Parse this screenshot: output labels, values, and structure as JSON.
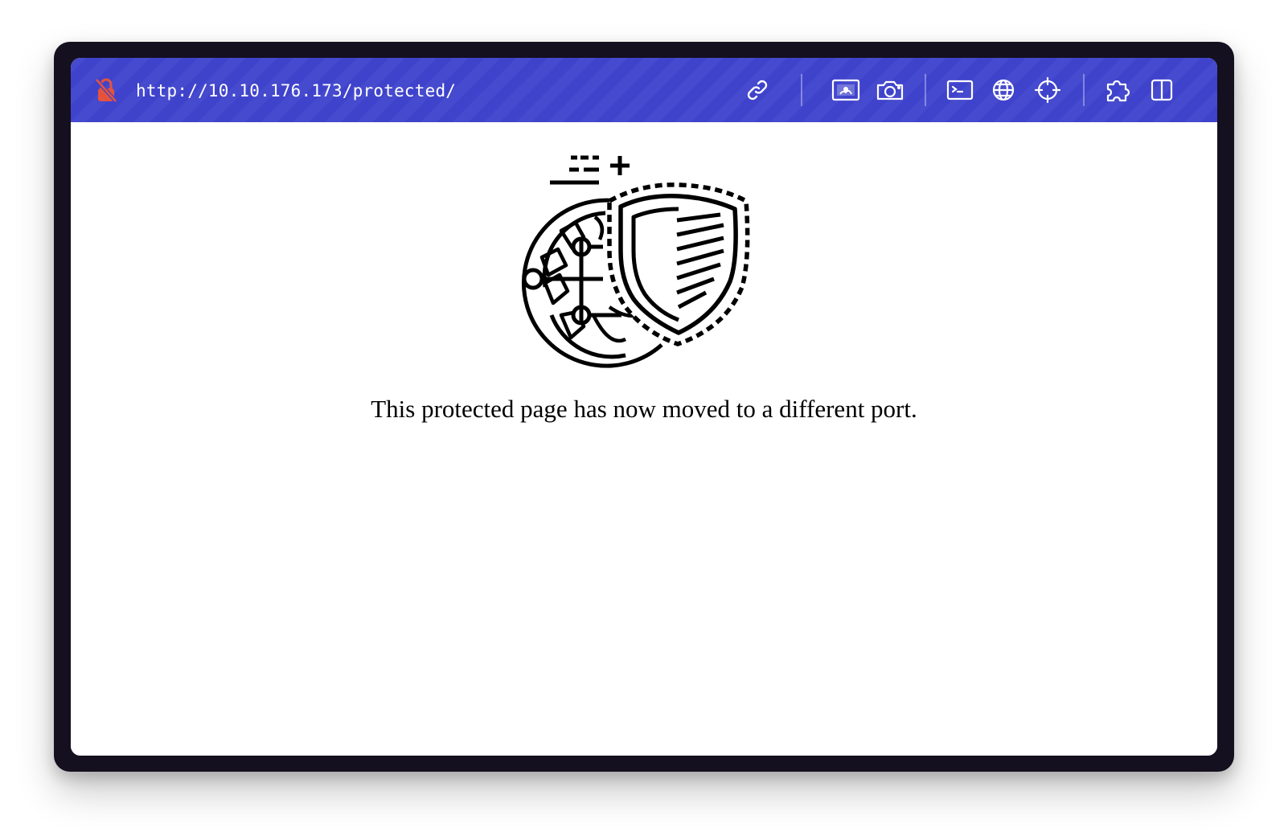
{
  "browser": {
    "url": "http://10.10.176.173/protected/",
    "accent_color": "#3f43cc",
    "lock_color": "#e5533d",
    "toolbar_icons": [
      "link-icon",
      "image-capture-icon",
      "camera-icon",
      "terminal-icon",
      "globe-icon",
      "crosshair-icon",
      "extension-icon",
      "sidebar-icon"
    ]
  },
  "page": {
    "illustration": "globe-shield-icon",
    "message": "This protected page has now moved to a different port."
  }
}
